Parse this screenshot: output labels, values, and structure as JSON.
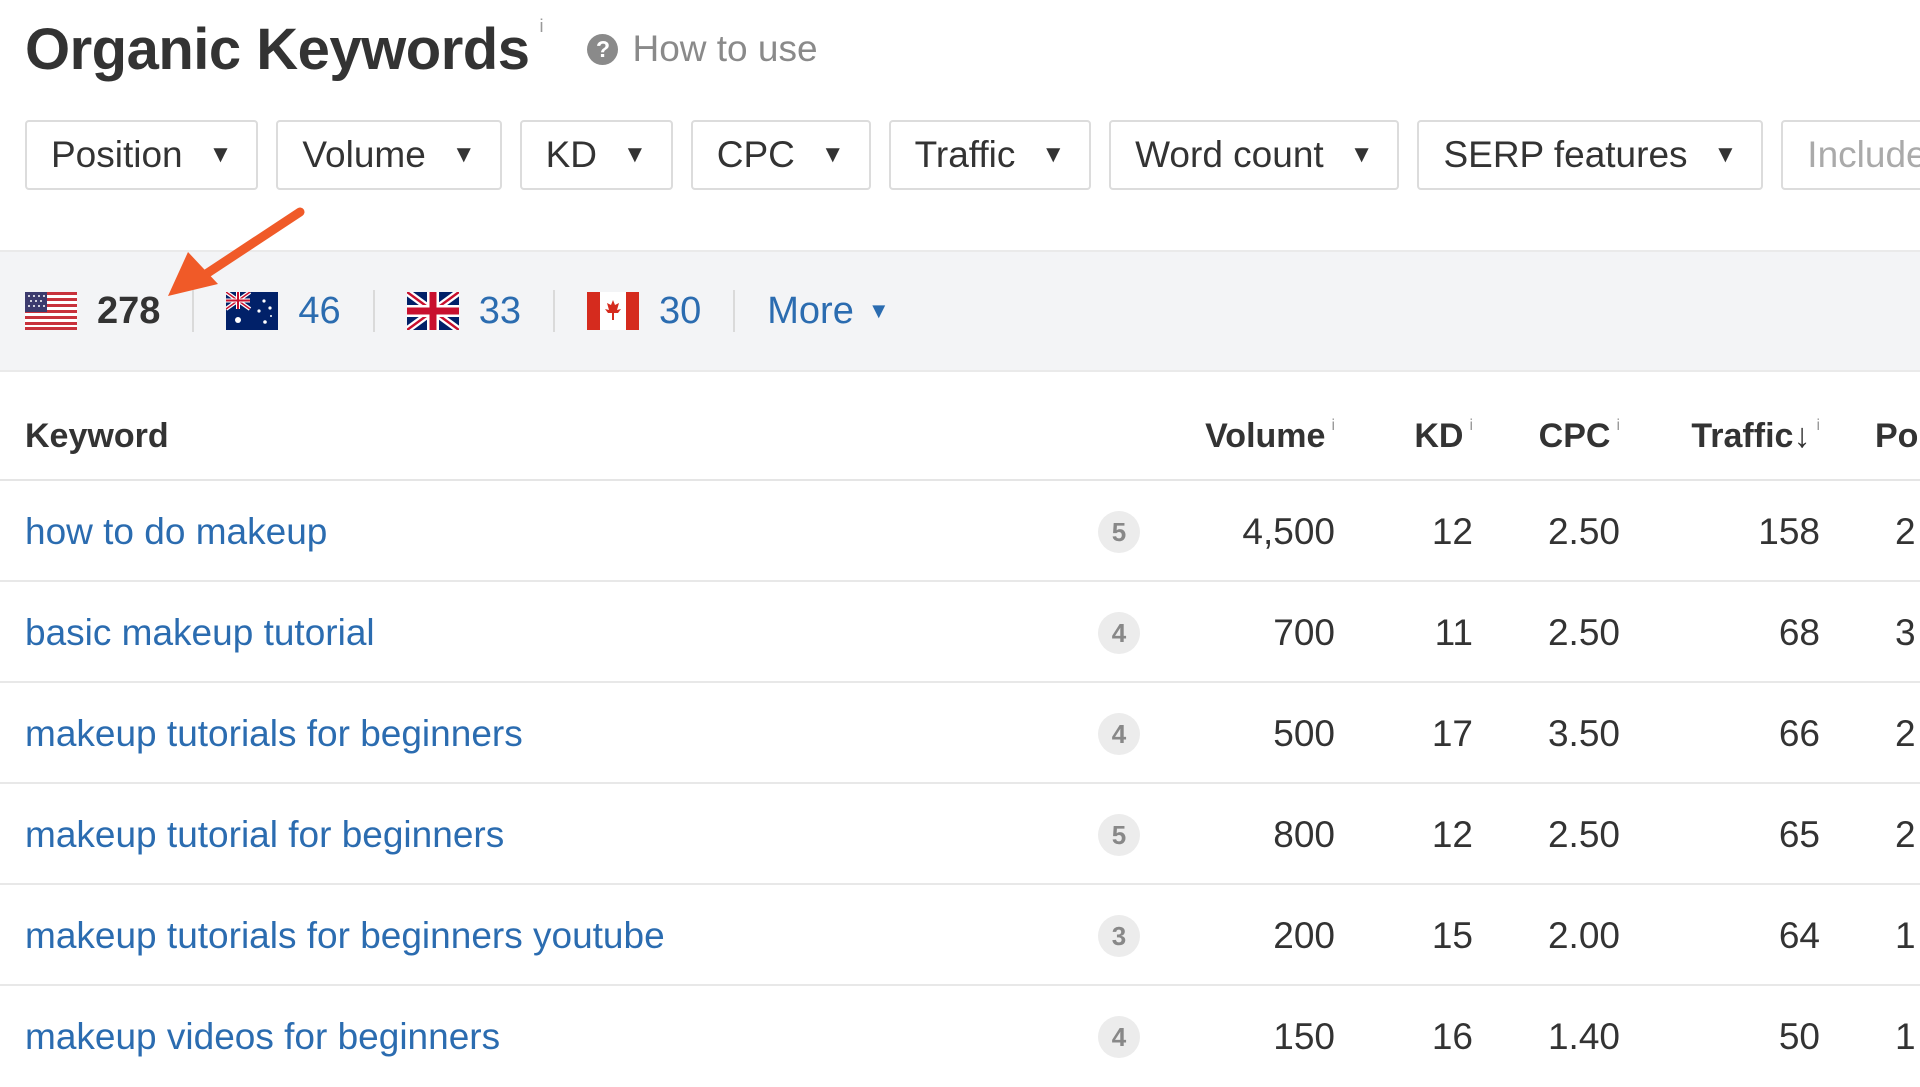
{
  "header": {
    "title": "Organic Keywords",
    "title_info": "i",
    "how_to_use": "How to use"
  },
  "filters": [
    {
      "label": "Position",
      "caret": "▼"
    },
    {
      "label": "Volume",
      "caret": "▼"
    },
    {
      "label": "KD",
      "caret": "▼"
    },
    {
      "label": "CPC",
      "caret": "▼"
    },
    {
      "label": "Traffic",
      "caret": "▼"
    },
    {
      "label": "Word count",
      "caret": "▼"
    },
    {
      "label": "SERP features",
      "caret": "▼"
    }
  ],
  "include_placeholder": "Include",
  "countries": [
    {
      "flag": "us-flag-icon",
      "count": "278",
      "active": true
    },
    {
      "flag": "au-flag-icon",
      "count": "46",
      "active": false
    },
    {
      "flag": "uk-flag-icon",
      "count": "33",
      "active": false
    },
    {
      "flag": "ca-flag-icon",
      "count": "30",
      "active": false
    }
  ],
  "more": {
    "label": "More",
    "caret": "▼"
  },
  "annotation_color": "#f05a28",
  "table": {
    "headers": {
      "keyword": "Keyword",
      "volume": "Volume",
      "kd": "KD",
      "cpc": "CPC",
      "traffic": "Traffic",
      "traffic_sort": "↓",
      "position": "Po",
      "info": "i"
    },
    "rows": [
      {
        "keyword": "how to do makeup",
        "words": "5",
        "volume": "4,500",
        "kd": "12",
        "cpc": "2.50",
        "traffic": "158",
        "position": "2"
      },
      {
        "keyword": "basic makeup tutorial",
        "words": "4",
        "volume": "700",
        "kd": "11",
        "cpc": "2.50",
        "traffic": "68",
        "position": "3"
      },
      {
        "keyword": "makeup tutorials for beginners",
        "words": "4",
        "volume": "500",
        "kd": "17",
        "cpc": "3.50",
        "traffic": "66",
        "position": "2"
      },
      {
        "keyword": "makeup tutorial for beginners",
        "words": "5",
        "volume": "800",
        "kd": "12",
        "cpc": "2.50",
        "traffic": "65",
        "position": "2"
      },
      {
        "keyword": "makeup tutorials for beginners youtube",
        "words": "3",
        "volume": "200",
        "kd": "15",
        "cpc": "2.00",
        "traffic": "64",
        "position": "1"
      },
      {
        "keyword": "makeup videos for beginners",
        "words": "4",
        "volume": "150",
        "kd": "16",
        "cpc": "1.40",
        "traffic": "50",
        "position": "1"
      }
    ]
  },
  "colors": {
    "link": "#2b6cb0",
    "text": "#333333",
    "bar_bg": "#f3f4f6"
  }
}
